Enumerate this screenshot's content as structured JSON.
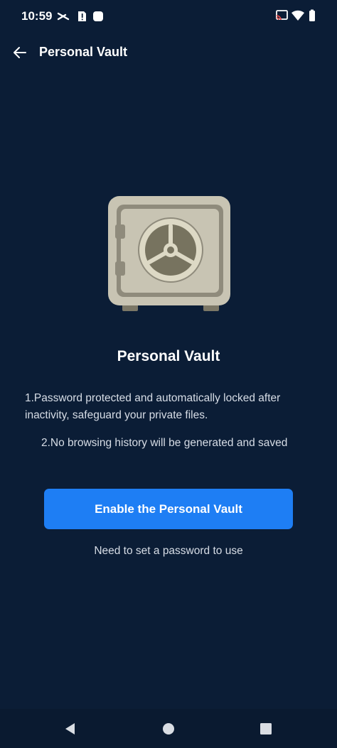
{
  "status_bar": {
    "time": "10:59",
    "left_icons": [
      "cut-icon",
      "sim-alert-icon",
      "square-app-icon"
    ],
    "right_icons": [
      "cast-icon",
      "wifi-icon",
      "battery-icon"
    ]
  },
  "app_bar": {
    "title": "Personal Vault",
    "back_icon": "arrow-left-icon"
  },
  "main": {
    "illustration": "safe-icon",
    "heading": "Personal Vault",
    "description_1": "1.Password protected and automatically locked after inactivity, safeguard your private files.",
    "description_2": "2.No browsing history will be generated and saved",
    "enable_button": "Enable the Personal Vault",
    "note": "Need to set a password to use"
  },
  "nav_bar": {
    "buttons": [
      "back-triangle-icon",
      "home-circle-icon",
      "recents-square-icon"
    ]
  },
  "colors": {
    "background": "#0b1d36",
    "accent": "#1e7ef4"
  }
}
